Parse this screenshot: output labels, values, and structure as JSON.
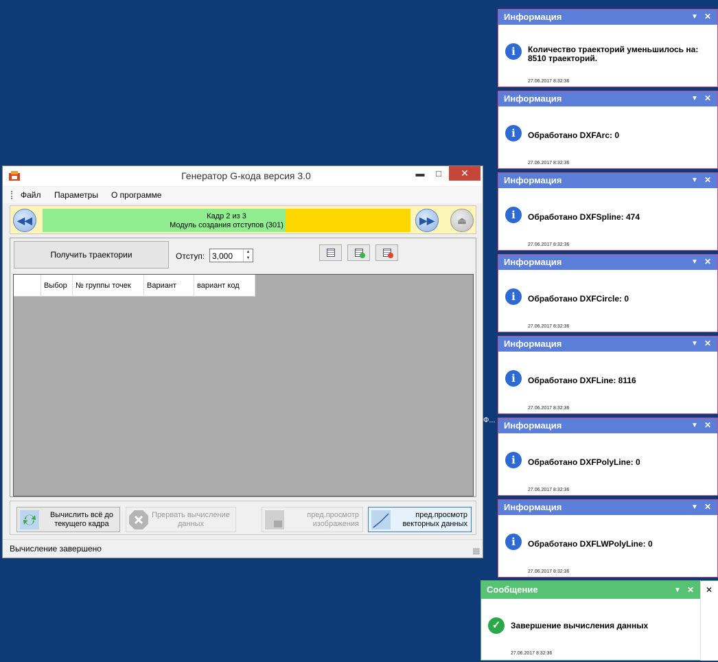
{
  "window": {
    "title": "Генератор G-кода версия 3.0",
    "min": "▬",
    "max": "□",
    "close": "✕"
  },
  "menu": {
    "items": [
      "Файл",
      "Параметры",
      "О программе"
    ]
  },
  "stepbar": {
    "progress": 0.66,
    "line1": "Кадр 2 из 3",
    "line2": "Модуль создания отступов (301)",
    "colors": {
      "fill": "#90ee90",
      "rest": "#ffd700"
    }
  },
  "panel": {
    "get_button": "Получить траектории",
    "offset_label": "Отступ:",
    "offset_value": "3,000"
  },
  "grid": {
    "columns": [
      "",
      "Выбор",
      "№ группы точек",
      "Вариант",
      "вариант код"
    ]
  },
  "actions": {
    "calc_all": "Вычислить всё до текущего кадра",
    "abort": "Прервать вычисление данных",
    "preview_image": "пред.просмотр изображения",
    "preview_vector": "пред.просмотр векторных данных"
  },
  "status": "Вычисление завершено",
  "notifications": [
    {
      "title": "Информация",
      "message": "Количество траекторий уменьшилось на: 8510 траекторий.",
      "time": "27.06.2017 8:32:36"
    },
    {
      "title": "Информация",
      "message": "Обработано DXFArc: 0",
      "time": "27.06.2017 8:32:36"
    },
    {
      "title": "Информация",
      "message": "Обработано DXFSpline: 474",
      "time": "27.06.2017 8:32:36"
    },
    {
      "title": "Информация",
      "message": "Обработано DXFCircle: 0",
      "time": "27.06.2017 8:32:36"
    },
    {
      "title": "Информация",
      "message": "Обработано DXFLine: 8116",
      "time": "27.06.2017 8:32:36"
    },
    {
      "title": "Информация",
      "message": "Обработано DXFPolyLine: 0",
      "time": "27.06.2017 8:32:36"
    },
    {
      "title": "Информация",
      "message": "Обработано DXFLWPolyLine: 0",
      "time": "27.06.2017 8:32:36"
    }
  ],
  "message": {
    "title": "Сообщение",
    "text": "Завершение вычисления данных",
    "time": "27.06.2017 8:32:36"
  },
  "icons": {
    "dropdown": "▼",
    "close": "✕",
    "info": "i",
    "check": "✓"
  },
  "stray_text": "Ф..."
}
